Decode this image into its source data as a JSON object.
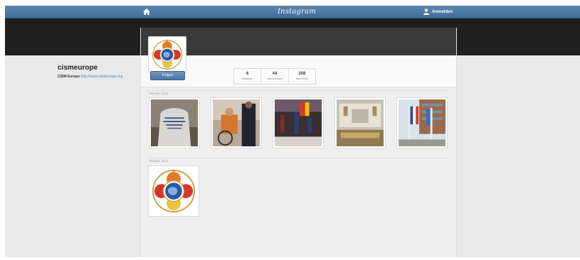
{
  "nav": {
    "brand": "Instagram",
    "user_label": "Anmelden"
  },
  "profile": {
    "username": "cismeurope",
    "bio_name": "CISM Europe",
    "bio_link": "http://www.cismeurope.org",
    "follow_label": "Folgen",
    "stats": [
      {
        "value": "6",
        "label": "Beiträge"
      },
      {
        "value": "44",
        "label": "Abonnenten"
      },
      {
        "value": "208",
        "label": "abonniert"
      }
    ]
  },
  "sections": [
    {
      "month": "Februar 2015",
      "photo_count": 5
    },
    {
      "month": "Oktober 2014",
      "photo_count": 1
    }
  ],
  "icons": {
    "home": "home-icon",
    "user": "user-icon",
    "logo": "cism-emblem"
  }
}
